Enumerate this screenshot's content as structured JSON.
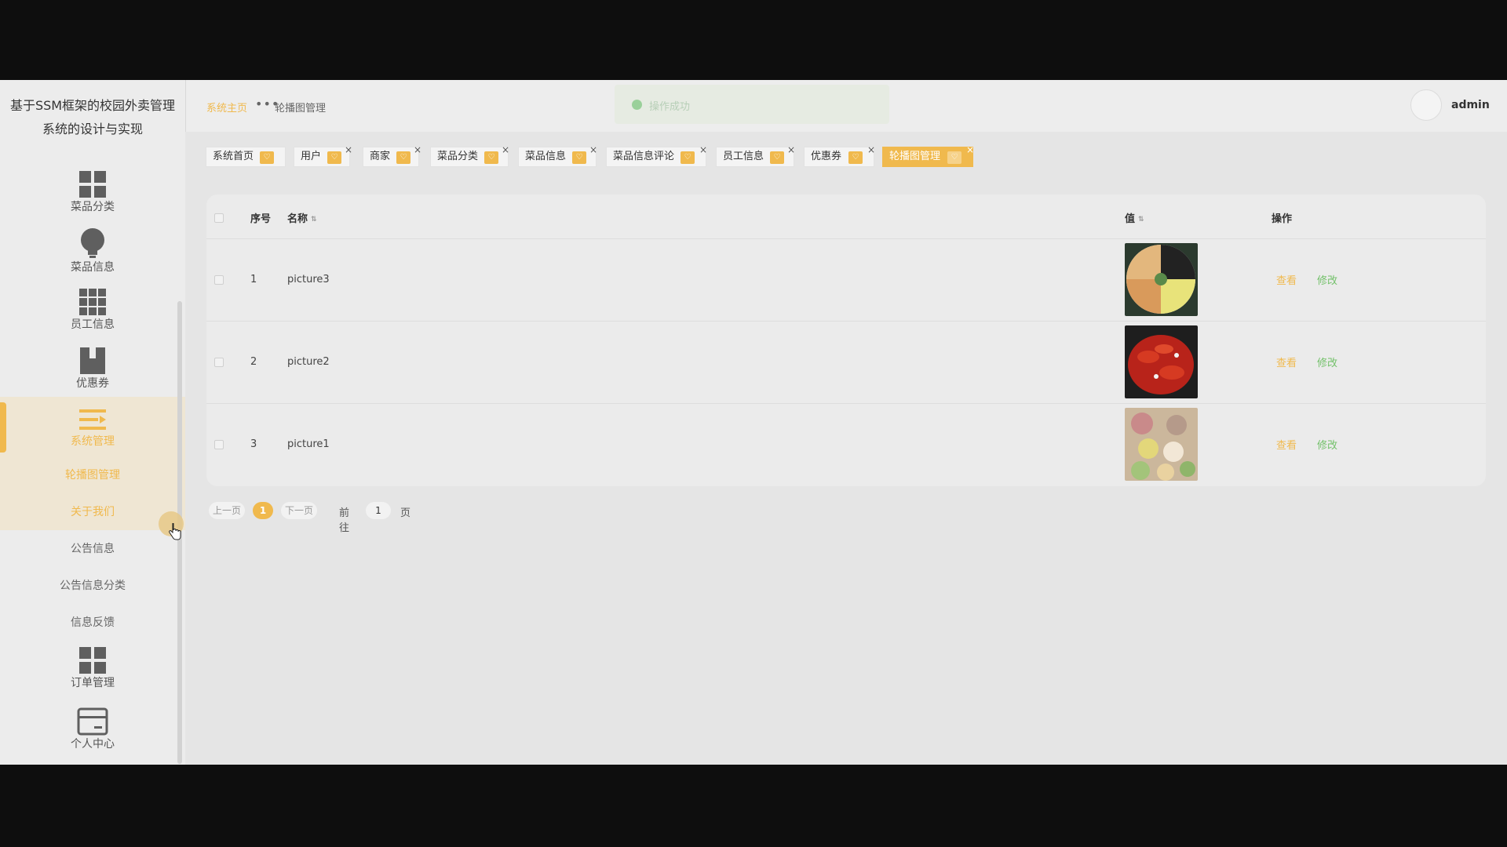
{
  "app": {
    "title": "基于SSM框架的校园外卖管理系统的设计与实现"
  },
  "sidebar": {
    "items": [
      {
        "label": "菜品分类",
        "icon": "grid-icon"
      },
      {
        "label": "菜品信息",
        "icon": "bulb-icon"
      },
      {
        "label": "员工信息",
        "icon": "grid9-icon"
      },
      {
        "label": "优惠券",
        "icon": "book-icon"
      },
      {
        "label": "系统管理",
        "icon": "menu-icon"
      },
      {
        "label": "订单管理",
        "icon": "grid-icon"
      },
      {
        "label": "个人中心",
        "icon": "card-icon"
      }
    ],
    "subitems": [
      "轮播图管理",
      "关于我们",
      "公告信息",
      "公告信息分类",
      "信息反馈"
    ]
  },
  "header": {
    "breadcrumb_home": "系统主页",
    "breadcrumb_dots": "•••",
    "breadcrumb_current": "轮播图管理",
    "toast": "操作成功",
    "user": "admin"
  },
  "tabs": [
    {
      "label": "系统首页"
    },
    {
      "label": "用户"
    },
    {
      "label": "商家"
    },
    {
      "label": "菜品分类"
    },
    {
      "label": "菜品信息"
    },
    {
      "label": "菜品信息评论"
    },
    {
      "label": "员工信息"
    },
    {
      "label": "优惠券"
    },
    {
      "label": "轮播图管理"
    }
  ],
  "table": {
    "headers": {
      "index": "序号",
      "name": "名称",
      "value": "值",
      "action": "操作"
    },
    "rows": [
      {
        "index": "1",
        "name": "picture3",
        "view": "查看",
        "edit": "修改"
      },
      {
        "index": "2",
        "name": "picture2",
        "view": "查看",
        "edit": "修改"
      },
      {
        "index": "3",
        "name": "picture1",
        "view": "查看",
        "edit": "修改"
      }
    ]
  },
  "pager": {
    "prev": "上一页",
    "current": "1",
    "next": "下一页",
    "goto": "前往",
    "goto_value": "1",
    "page_unit": "页"
  },
  "colors": {
    "accent": "#f0b94d",
    "success": "#73c16a"
  }
}
